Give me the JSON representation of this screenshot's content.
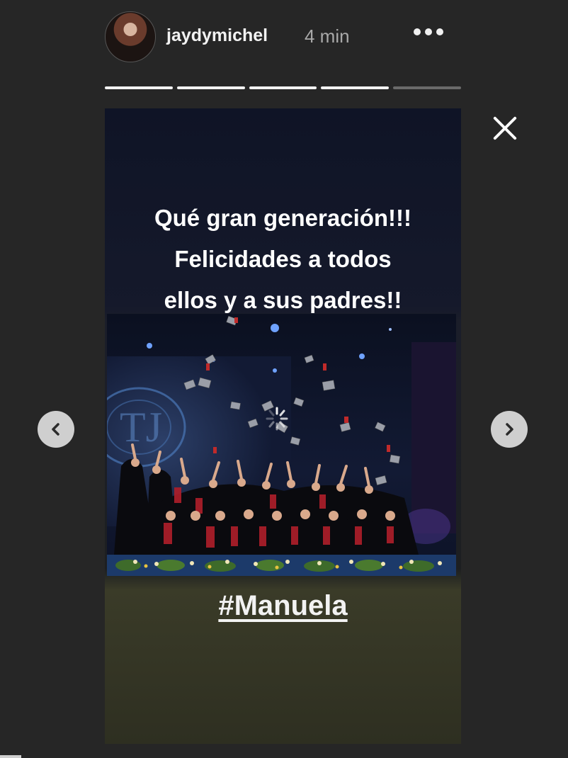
{
  "header": {
    "username": "jaydymichel",
    "time": "4 min",
    "more_icon": "more-horizontal-icon"
  },
  "progress": {
    "segments": [
      1,
      1,
      1,
      1,
      0
    ]
  },
  "story": {
    "caption_lines": [
      "Qué gran generación!!!",
      "Felicidades a todos",
      "ellos y a sus padres!!"
    ],
    "hashtag": "#Manuela"
  },
  "controls": {
    "close_icon": "close-icon",
    "prev_icon": "chevron-left-icon",
    "next_icon": "chevron-right-icon"
  },
  "colors": {
    "background": "#262626",
    "progress_active": "#f2f2f2",
    "progress_inactive": "#6a6a6a",
    "nav_button": "#cfcfcf"
  }
}
